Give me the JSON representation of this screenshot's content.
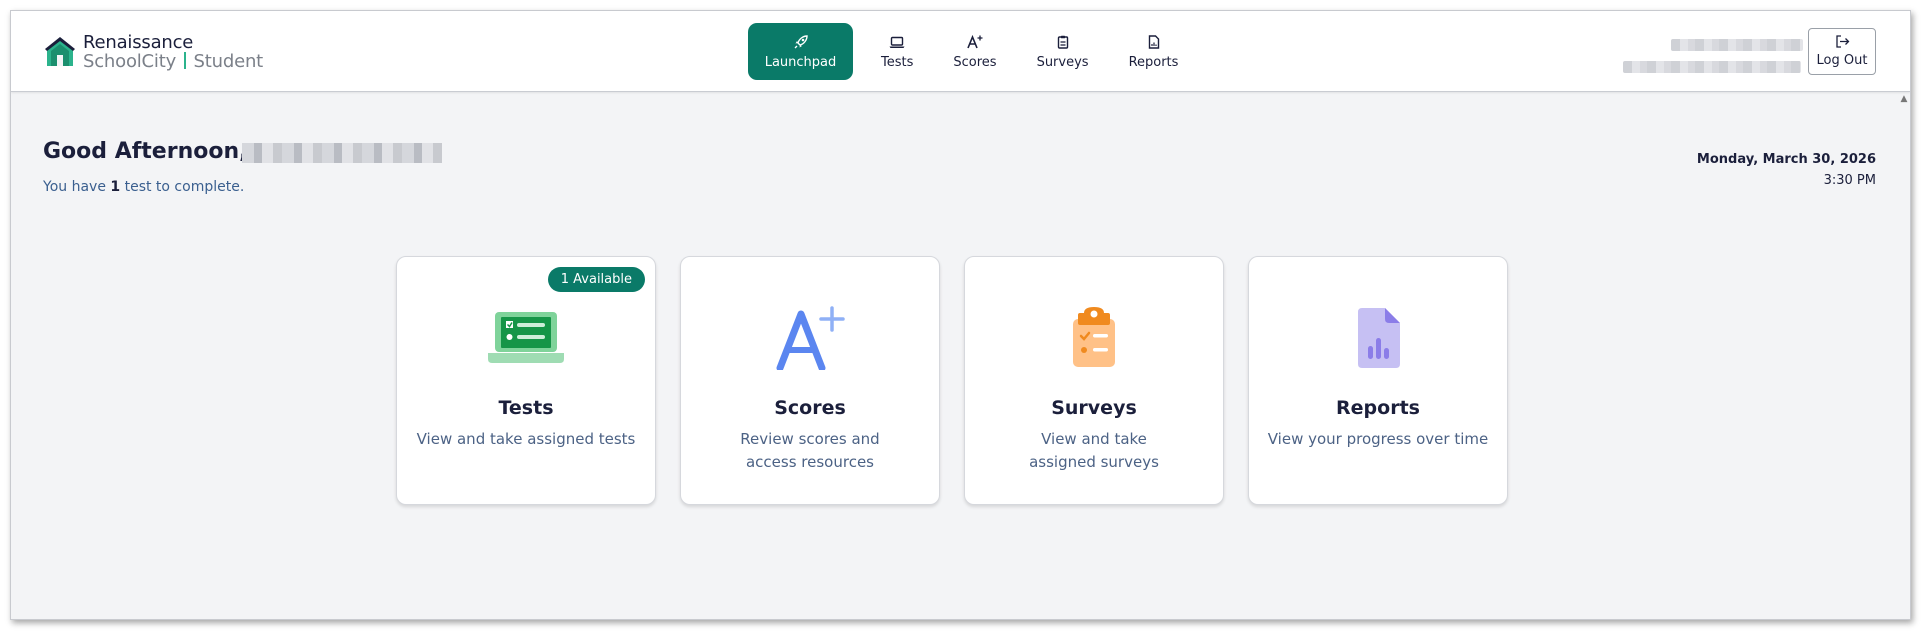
{
  "brand": {
    "line1": "Renaissance",
    "line2a": "SchoolCity",
    "line2b": "Student",
    "accent": "#2bb38c"
  },
  "nav": {
    "items": [
      {
        "label": "Launchpad",
        "icon": "rocket-icon",
        "active": true
      },
      {
        "label": "Tests",
        "icon": "laptop-icon"
      },
      {
        "label": "Scores",
        "icon": "a-plus-icon"
      },
      {
        "label": "Surveys",
        "icon": "clipboard-icon"
      },
      {
        "label": "Reports",
        "icon": "report-file-icon"
      }
    ],
    "active_color": "#0a7a68"
  },
  "header": {
    "logout_label": "Log Out"
  },
  "greeting": {
    "prefix": "Good Afternoon,",
    "sub_before": "You have ",
    "sub_count": "1",
    "sub_after": " test to complete."
  },
  "datetime": {
    "date": "Monday, March 30, 2026",
    "time": "3:30 PM"
  },
  "cards": [
    {
      "title": "Tests",
      "desc": "View and take assigned tests",
      "badge": "1 Available",
      "icon": "laptop-checklist-icon"
    },
    {
      "title": "Scores",
      "desc": "Review scores and access resources",
      "icon": "a-plus-icon"
    },
    {
      "title": "Surveys",
      "desc": "View and take assigned surveys",
      "icon": "clipboard-checklist-icon"
    },
    {
      "title": "Reports",
      "desc": "View your progress over time",
      "icon": "bar-chart-file-icon"
    }
  ]
}
